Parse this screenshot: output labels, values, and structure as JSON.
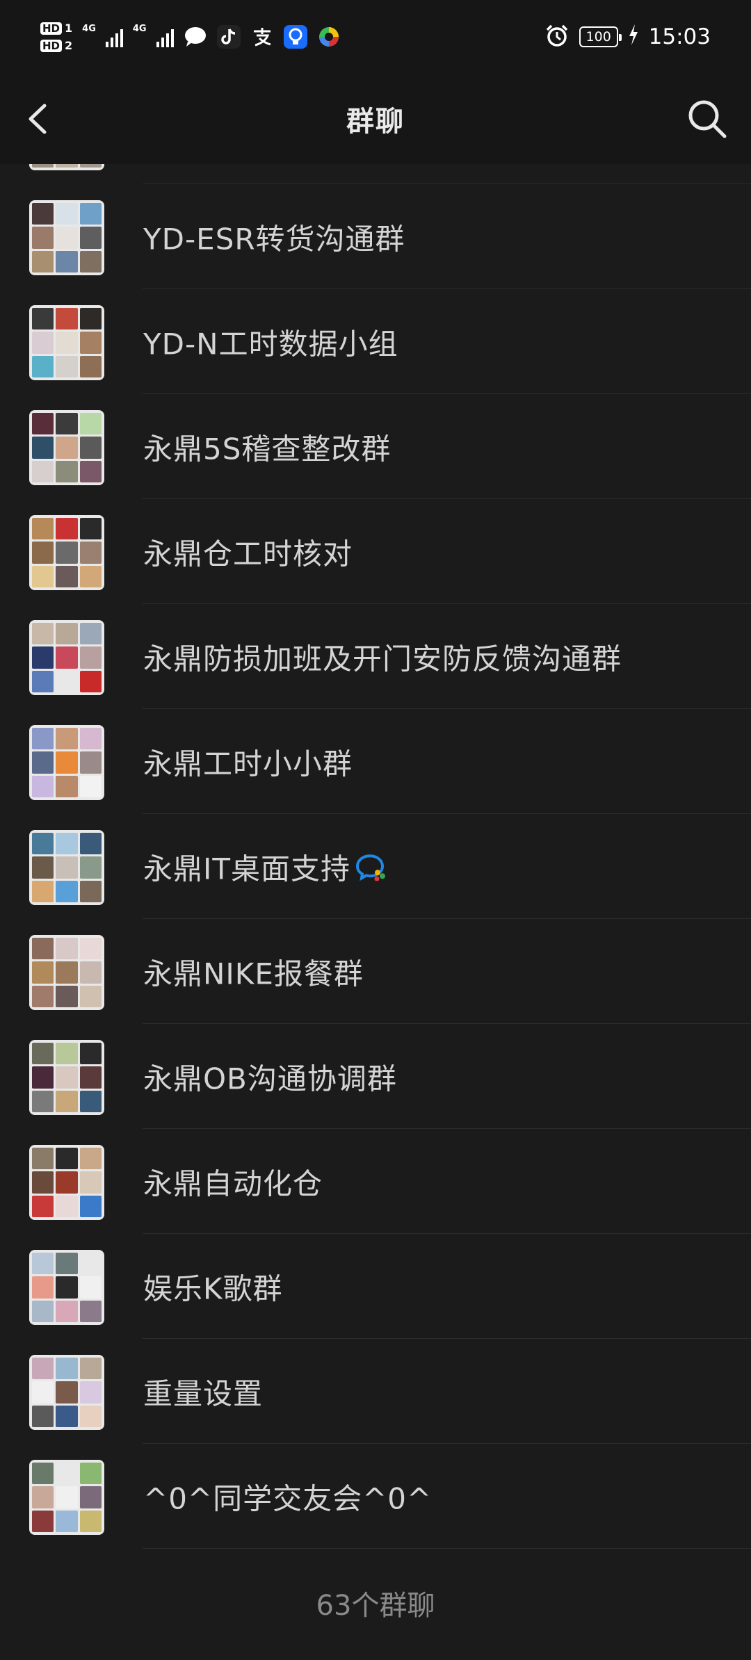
{
  "status_bar": {
    "hd1": "HD",
    "hd1_num": "1",
    "hd2": "HD",
    "hd2_num": "2",
    "net1": "4G",
    "net2": "4G",
    "battery": "100",
    "time": "15:03",
    "icons": [
      "message-icon",
      "tiktok-icon",
      "alipay-icon",
      "bulb-app-icon",
      "pinwheel-app-icon",
      "alarm-icon",
      "charging-icon"
    ]
  },
  "header": {
    "title": "群聊",
    "back_icon": "chevron-left-icon",
    "search_icon": "search-icon"
  },
  "groups": [
    {
      "name": "YD-ESR转货沟通群"
    },
    {
      "name": "YD-N工时数据小组"
    },
    {
      "name": "永鼎5S稽查整改群"
    },
    {
      "name": "永鼎仓工时核对"
    },
    {
      "name": "永鼎防损加班及开门安防反馈沟通群"
    },
    {
      "name": "永鼎工时小小群"
    },
    {
      "name": "永鼎IT桌面支持"
    },
    {
      "name": "永鼎NIKE报餐群"
    },
    {
      "name": "永鼎OB沟通协调群"
    },
    {
      "name": "永鼎自动化仓"
    },
    {
      "name": "娱乐K歌群"
    },
    {
      "name": "重量设置"
    },
    {
      "name": "^0^同学交友会^0^"
    }
  ],
  "footer": {
    "count_text": "63个群聊"
  },
  "colors": {
    "background": "#1b1b1b",
    "header": "#161616",
    "text": "#d4d4d4",
    "muted": "#8a8a8a",
    "divider": "#2c2c2c"
  }
}
